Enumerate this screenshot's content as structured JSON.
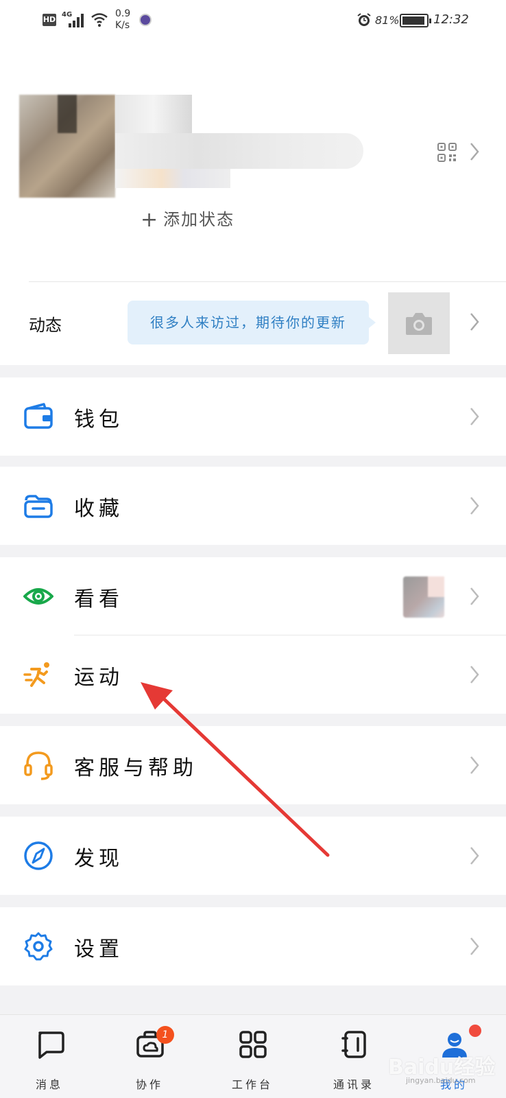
{
  "status_bar": {
    "hd": "HD",
    "network": "4G",
    "speed": "0.9\nK/s",
    "battery_pct": "81%",
    "time": "12:32"
  },
  "profile": {
    "add_status": "添加状态"
  },
  "moments": {
    "label": "动态",
    "bubble_text": "很多人来访过，期待你的更新"
  },
  "menu": {
    "wallet": "钱包",
    "favorites": "收藏",
    "kankan": "看看",
    "sports": "运动",
    "support": "客服与帮助",
    "discover": "发现",
    "settings": "设置"
  },
  "bottom_nav": {
    "items": [
      {
        "label": "消息",
        "icon": "chat-icon"
      },
      {
        "label": "协作",
        "icon": "collab-icon",
        "badge": "1"
      },
      {
        "label": "工作台",
        "icon": "workbench-icon"
      },
      {
        "label": "通讯录",
        "icon": "contacts-icon"
      },
      {
        "label": "我的",
        "icon": "profile-icon",
        "active": true
      }
    ]
  },
  "watermark": {
    "text": "Baidu经验",
    "sub": "jingyan.baidu.com"
  },
  "colors": {
    "accent_blue": "#1e7ce6",
    "green": "#18a84a",
    "orange": "#f39a1e",
    "badge_red": "#f4511e"
  }
}
